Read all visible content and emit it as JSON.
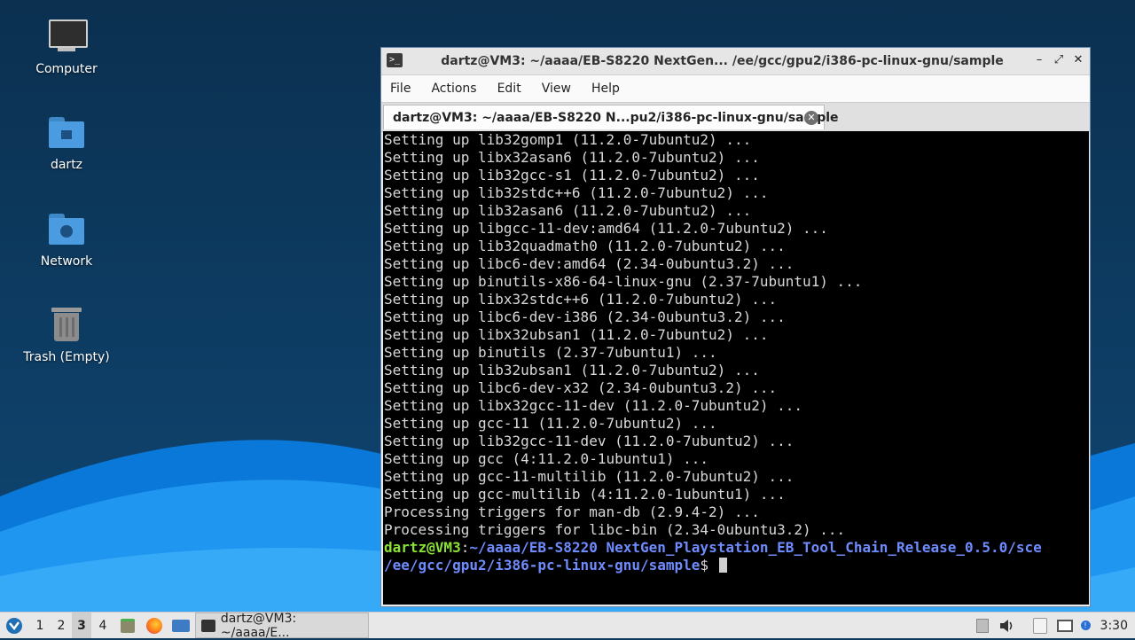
{
  "desktop": {
    "icons": [
      {
        "label": "Computer",
        "icon": "monitor-icon"
      },
      {
        "label": "dartz",
        "icon": "home-folder-icon"
      },
      {
        "label": "Network",
        "icon": "network-folder-icon"
      },
      {
        "label": "Trash (Empty)",
        "icon": "trash-icon"
      }
    ]
  },
  "window": {
    "title": "dartz@VM3: ~/aaaa/EB-S8220 NextGen... /ee/gcc/gpu2/i386-pc-linux-gnu/sample",
    "controls": {
      "minimize": "–",
      "maximize": "⤢",
      "close": "✕"
    },
    "menu": [
      "File",
      "Actions",
      "Edit",
      "View",
      "Help"
    ],
    "tab_label": "dartz@VM3: ~/aaaa/EB-S8220 N...pu2/i386-pc-linux-gnu/sample",
    "tab_close": "✕"
  },
  "terminal": {
    "lines": [
      "Setting up lib32gomp1 (11.2.0-7ubuntu2) ...",
      "Setting up libx32asan6 (11.2.0-7ubuntu2) ...",
      "Setting up lib32gcc-s1 (11.2.0-7ubuntu2) ...",
      "Setting up lib32stdc++6 (11.2.0-7ubuntu2) ...",
      "Setting up lib32asan6 (11.2.0-7ubuntu2) ...",
      "Setting up libgcc-11-dev:amd64 (11.2.0-7ubuntu2) ...",
      "Setting up lib32quadmath0 (11.2.0-7ubuntu2) ...",
      "Setting up libc6-dev:amd64 (2.34-0ubuntu3.2) ...",
      "Setting up binutils-x86-64-linux-gnu (2.37-7ubuntu1) ...",
      "Setting up libx32stdc++6 (11.2.0-7ubuntu2) ...",
      "Setting up libc6-dev-i386 (2.34-0ubuntu3.2) ...",
      "Setting up libx32ubsan1 (11.2.0-7ubuntu2) ...",
      "Setting up binutils (2.37-7ubuntu1) ...",
      "Setting up lib32ubsan1 (11.2.0-7ubuntu2) ...",
      "Setting up libc6-dev-x32 (2.34-0ubuntu3.2) ...",
      "Setting up libx32gcc-11-dev (11.2.0-7ubuntu2) ...",
      "Setting up gcc-11 (11.2.0-7ubuntu2) ...",
      "Setting up lib32gcc-11-dev (11.2.0-7ubuntu2) ...",
      "Setting up gcc (4:11.2.0-1ubuntu1) ...",
      "Setting up gcc-11-multilib (11.2.0-7ubuntu2) ...",
      "Setting up gcc-multilib (4:11.2.0-1ubuntu1) ...",
      "Processing triggers for man-db (2.9.4-2) ...",
      "Processing triggers for libc-bin (2.34-0ubuntu3.2) ..."
    ],
    "prompt_user": "dartz@VM3",
    "prompt_sep": ":",
    "prompt_path_1": "~/aaaa/EB-S8220 NextGen_Playstation_EB_Tool_Chain_Release_0.5.0/sce",
    "prompt_path_2": "/ee/gcc/gpu2/i386-pc-linux-gnu/sample",
    "prompt_symbol": "$ "
  },
  "taskbar": {
    "workspaces": [
      "1",
      "2",
      "3",
      "4"
    ],
    "active_workspace": "3",
    "task_label": "dartz@VM3: ~/aaaa/E...",
    "clock": "3:30"
  }
}
